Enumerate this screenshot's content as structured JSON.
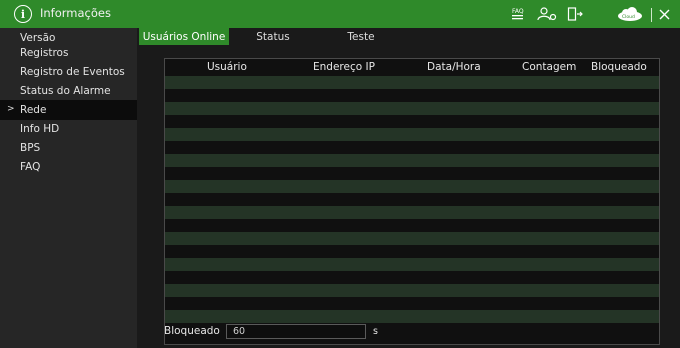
{
  "window": {
    "title": "Informações"
  },
  "toolbar_icons": [
    "info-icon",
    "faq-icon",
    "user-settings-icon",
    "logout-icon",
    "cloud-icon",
    "close-icon"
  ],
  "cloud_label": "Cloud",
  "sidebar": {
    "items": [
      {
        "label": "Versão"
      },
      {
        "label": "Registros"
      },
      {
        "label": "Registro de Eventos"
      },
      {
        "label": "Status do Alarme"
      },
      {
        "label": "Rede",
        "active": true
      },
      {
        "label": "Info HD"
      },
      {
        "label": "BPS"
      },
      {
        "label": "FAQ"
      }
    ],
    "active_marker": ">"
  },
  "tabs": [
    {
      "label": "Usuários Online",
      "active": true
    },
    {
      "label": "Status"
    },
    {
      "label": "Teste"
    }
  ],
  "table": {
    "columns": [
      "Usuário",
      "Endereço IP",
      "Data/Hora",
      "Contagem",
      "Bloqueado"
    ],
    "rows": []
  },
  "footer": {
    "blocked_label": "Bloqueado",
    "blocked_value": "60",
    "blocked_unit": "s"
  },
  "colors": {
    "accent": "#2f8a2a",
    "sidebar_bg": "#262626",
    "content_bg": "#1a1a1a",
    "row_alt": "#243426"
  }
}
